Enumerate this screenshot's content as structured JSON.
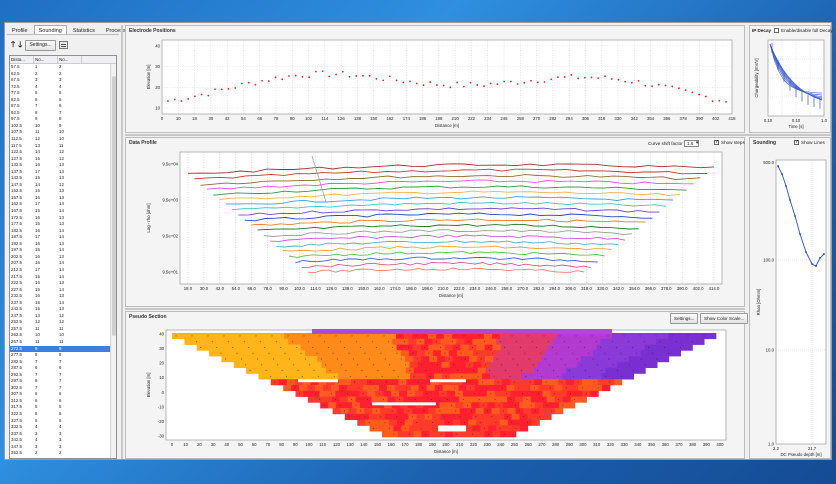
{
  "tabs": [
    "Profile",
    "Sounding",
    "Statistics",
    "Processing"
  ],
  "active_tab": 1,
  "toolbar": {
    "settings_label": "Settings..."
  },
  "table": {
    "headers": [
      "Dista...",
      "No...",
      "No..."
    ],
    "rows": [
      [
        "57.5",
        "1",
        "2"
      ],
      [
        "62.5",
        "2",
        "2"
      ],
      [
        "67.5",
        "3",
        "3"
      ],
      [
        "72.5",
        "4",
        "4"
      ],
      [
        "77.5",
        "5",
        "5"
      ],
      [
        "82.5",
        "6",
        "5"
      ],
      [
        "87.5",
        "7",
        "6"
      ],
      [
        "92.5",
        "8",
        "7"
      ],
      [
        "97.5",
        "9",
        "8"
      ],
      [
        "102.5",
        "10",
        "9"
      ],
      [
        "107.5",
        "11",
        "10"
      ],
      [
        "112.5",
        "12",
        "10"
      ],
      [
        "117.5",
        "13",
        "11"
      ],
      [
        "122.5",
        "14",
        "12"
      ],
      [
        "127.5",
        "15",
        "12"
      ],
      [
        "132.5",
        "16",
        "13"
      ],
      [
        "137.5",
        "17",
        "13"
      ],
      [
        "142.5",
        "15",
        "13"
      ],
      [
        "147.5",
        "14",
        "12"
      ],
      [
        "152.5",
        "15",
        "13"
      ],
      [
        "157.5",
        "16",
        "13"
      ],
      [
        "162.5",
        "17",
        "14"
      ],
      [
        "167.5",
        "15",
        "14"
      ],
      [
        "172.5",
        "16",
        "13"
      ],
      [
        "177.5",
        "15",
        "13"
      ],
      [
        "182.5",
        "16",
        "14"
      ],
      [
        "187.5",
        "17",
        "14"
      ],
      [
        "192.5",
        "16",
        "13"
      ],
      [
        "197.5",
        "15",
        "14"
      ],
      [
        "202.5",
        "16",
        "13"
      ],
      [
        "207.5",
        "16",
        "14"
      ],
      [
        "212.5",
        "17",
        "14"
      ],
      [
        "217.5",
        "15",
        "14"
      ],
      [
        "222.5",
        "16",
        "13"
      ],
      [
        "227.5",
        "15",
        "14"
      ],
      [
        "232.5",
        "16",
        "13"
      ],
      [
        "237.5",
        "15",
        "14"
      ],
      [
        "242.5",
        "15",
        "13"
      ],
      [
        "247.5",
        "13",
        "12"
      ],
      [
        "252.5",
        "12",
        "12"
      ],
      [
        "257.5",
        "11",
        "11"
      ],
      [
        "262.5",
        "10",
        "10"
      ],
      [
        "267.5",
        "11",
        "11"
      ],
      [
        "272.5",
        "9",
        "9"
      ],
      [
        "277.5",
        "8",
        "8"
      ],
      [
        "282.5",
        "7",
        "7"
      ],
      [
        "287.5",
        "6",
        "6"
      ],
      [
        "292.5",
        "7",
        "7"
      ],
      [
        "297.5",
        "8",
        "7"
      ],
      [
        "302.5",
        "7",
        "7"
      ],
      [
        "307.5",
        "6",
        "6"
      ],
      [
        "312.5",
        "6",
        "6"
      ],
      [
        "317.5",
        "5",
        "5"
      ],
      [
        "322.5",
        "6",
        "5"
      ],
      [
        "327.5",
        "5",
        "5"
      ],
      [
        "332.5",
        "4",
        "4"
      ],
      [
        "337.5",
        "3",
        "3"
      ],
      [
        "342.5",
        "4",
        "3"
      ],
      [
        "347.5",
        "3",
        "3"
      ],
      [
        "352.5",
        "2",
        "2"
      ],
      [
        "357.5",
        "1",
        "1"
      ]
    ],
    "selected_row": 43
  },
  "electrode": {
    "title": "Electrode Positions",
    "ylabel": "Elevation [m]",
    "xlabel": "Distance [m]",
    "yticks": [
      "40",
      "30",
      "20",
      "10"
    ],
    "xticks": [
      "0",
      "10",
      "18",
      "30",
      "42",
      "54",
      "66",
      "78",
      "90",
      "102",
      "114",
      "126",
      "138",
      "150",
      "162",
      "174",
      "186",
      "198",
      "210",
      "222",
      "234",
      "246",
      "258",
      "270",
      "282",
      "294",
      "306",
      "318",
      "330",
      "342",
      "354",
      "366",
      "378",
      "390",
      "402",
      "418"
    ]
  },
  "ip_decay": {
    "title": "IP Decay",
    "checkbox_label": "Enable/disable full Decay",
    "ylabel": "Chargeability [mV/V]",
    "xlabel": "Time [s]",
    "xticks": [
      "0.10",
      "0.10",
      "1.0"
    ]
  },
  "data_profile": {
    "title": "Data Profile",
    "curve_shift_label": "Curve shift factor",
    "curve_shift_value": "1.6",
    "show_steps_label": "Show steps",
    "ylabel": "Log - rho [ohm]",
    "xlabel": "Distance [m]",
    "yticks": [
      "9.5e+04",
      "9.5e+03",
      "9.5e+02",
      "9.5e+01"
    ],
    "xticks": [
      "18.0",
      "30.0",
      "42.0",
      "54.0",
      "66.0",
      "78.0",
      "90.0",
      "102.0",
      "114.0",
      "126.0",
      "138.0",
      "150.0",
      "162.0",
      "174.0",
      "186.0",
      "198.0",
      "210.0",
      "222.0",
      "234.0",
      "246.0",
      "258.0",
      "270.0",
      "282.0",
      "294.0",
      "306.0",
      "318.0",
      "330.0",
      "342.0",
      "354.0",
      "366.0",
      "378.0",
      "390.0",
      "402.0",
      "414.0"
    ]
  },
  "sounding": {
    "title": "Sounding",
    "show_lines_label": "Show Lines",
    "ylabel": "Rhoa [Ohmm]",
    "xlabel": "DC Pseudo depth [m]",
    "yticks": [
      "100.0",
      "10.0",
      "1.0"
    ],
    "top_label": "500.0",
    "xticks": [
      "2.2",
      "21.7"
    ]
  },
  "pseudo": {
    "title": "Pseudo Section",
    "settings_label": "Settings...",
    "color_scale_label": "Show Color Scale...",
    "ylabel": "Elevation [m]",
    "xlabel": "Distance [m]",
    "yticks": [
      "40",
      "30",
      "20",
      "10",
      "0",
      "-10",
      "-20",
      "-30"
    ],
    "xticks": [
      "0",
      "10",
      "20",
      "30",
      "40",
      "50",
      "60",
      "70",
      "80",
      "90",
      "100",
      "110",
      "120",
      "130",
      "140",
      "150",
      "160",
      "170",
      "180",
      "190",
      "200",
      "210",
      "220",
      "230",
      "240",
      "250",
      "260",
      "270",
      "280",
      "290",
      "300",
      "310",
      "320",
      "330",
      "340",
      "350",
      "360",
      "370",
      "380",
      "390",
      "400"
    ]
  },
  "colors": {
    "profile_curves": [
      "#a13030",
      "#c0392b",
      "#8e6b2f",
      "#e056e0",
      "#2a9a3c",
      "#f0b44a",
      "#3f9ee0",
      "#3ec2c2",
      "#6e43c9",
      "#2748b8",
      "#e07f2a",
      "#1f7a1f",
      "#9b9b9b",
      "#c75bd1",
      "#4fb0c6",
      "#e8a23f",
      "#5bbd4f",
      "#3e61d6",
      "#d25a8f",
      "#f27b6d"
    ],
    "heat": [
      "#ff1f2e",
      "#ff3a2a",
      "#ff5b1f",
      "#ff8a1a",
      "#ffb41a",
      "#e23a6b",
      "#b23ad0",
      "#8a3ad8",
      "#7a2fd0"
    ]
  }
}
